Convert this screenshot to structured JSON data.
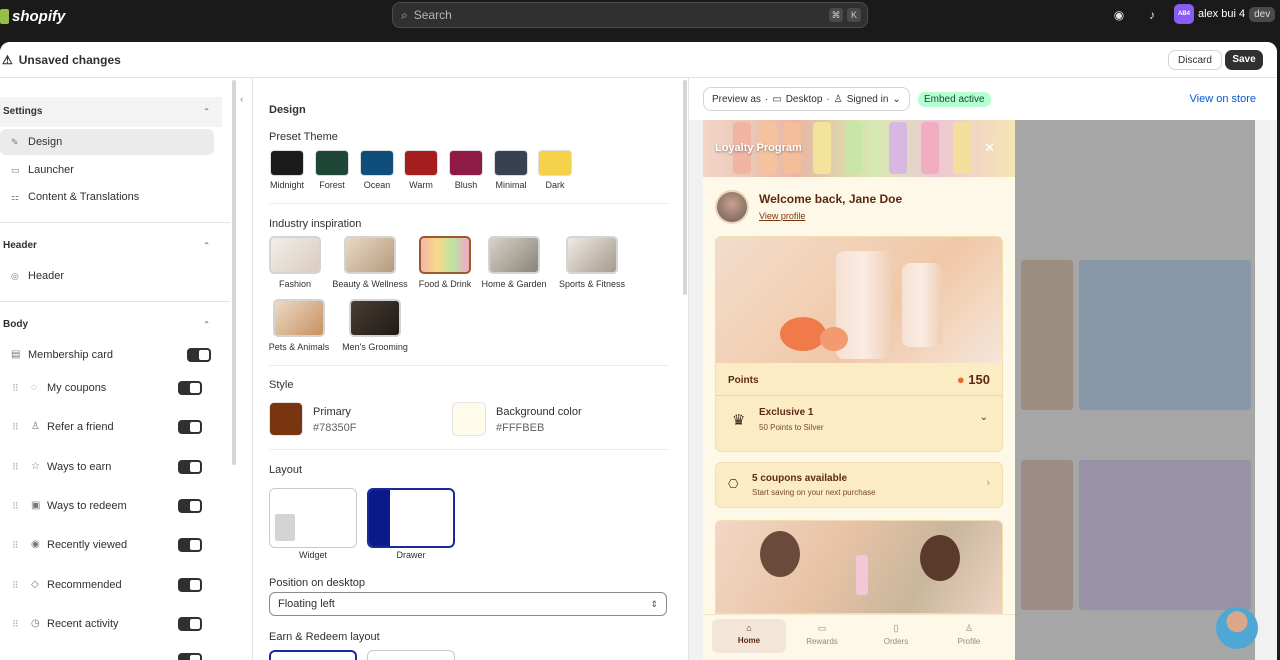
{
  "topbar": {
    "brand": "shopify",
    "search_placeholder": "Search",
    "kbd1": "⌘",
    "kbd2": "K",
    "user_name": "alex bui 4",
    "user_initials": "AB4",
    "store_badge": "dev"
  },
  "editor": {
    "status": "Unsaved changes",
    "discard": "Discard",
    "save": "Save"
  },
  "sidebar": {
    "settings": {
      "title": "Settings",
      "items": [
        {
          "label": "Design",
          "active": true
        },
        {
          "label": "Launcher"
        },
        {
          "label": "Content & Translations"
        }
      ]
    },
    "header": {
      "title": "Header",
      "items": [
        {
          "label": "Header"
        }
      ]
    },
    "body": {
      "title": "Body",
      "items": [
        {
          "label": "Membership card"
        },
        {
          "label": "My coupons"
        },
        {
          "label": "Refer a friend"
        },
        {
          "label": "Ways to earn"
        },
        {
          "label": "Ways to redeem"
        },
        {
          "label": "Recently viewed"
        },
        {
          "label": "Recommended"
        },
        {
          "label": "Recent activity"
        }
      ]
    }
  },
  "design": {
    "title": "Design",
    "preset_label": "Preset Theme",
    "presets": [
      {
        "name": "Midnight",
        "color": "#1a1a1a"
      },
      {
        "name": "Forest",
        "color": "#1f4636"
      },
      {
        "name": "Ocean",
        "color": "#0f4d7a"
      },
      {
        "name": "Warm",
        "color": "#a51d1d"
      },
      {
        "name": "Blush",
        "color": "#8e1a45"
      },
      {
        "name": "Minimal",
        "color": "#374151"
      },
      {
        "name": "Dark",
        "color": "#f5d24a"
      }
    ],
    "industry_label": "Industry inspiration",
    "industries": [
      {
        "name": "Fashion"
      },
      {
        "name": "Beauty & Wellness"
      },
      {
        "name": "Food & Drink",
        "selected": true
      },
      {
        "name": "Home & Garden"
      },
      {
        "name": "Sports & Fitness"
      },
      {
        "name": "Pets & Animals"
      },
      {
        "name": "Men's Grooming"
      }
    ],
    "style_label": "Style",
    "primary_label": "Primary",
    "primary_hex": "#78350F",
    "bg_label": "Background color",
    "bg_hex": "#FFFBEB",
    "layout_label": "Layout",
    "layout_widget": "Widget",
    "layout_drawer": "Drawer",
    "position_label": "Position on desktop",
    "position_value": "Floating left",
    "earn_label": "Earn & Redeem layout"
  },
  "preview": {
    "preview_as": "Preview as",
    "device": "Desktop",
    "signed": "Signed in",
    "embed": "Embed active",
    "view_store": "View on store",
    "banner_title": "Loyalty Program",
    "welcome": "Welcome back, Jane Doe",
    "view_profile": "View profile",
    "points_label": "Points",
    "points_value": "150",
    "tier_name": "Exclusive 1",
    "tier_sub": "50 Points to Silver",
    "coupons_title": "5 coupons available",
    "coupons_sub": "Start saving on your next purchase",
    "nav": [
      {
        "label": "Home"
      },
      {
        "label": "Rewards"
      },
      {
        "label": "Orders"
      },
      {
        "label": "Profile"
      }
    ]
  }
}
